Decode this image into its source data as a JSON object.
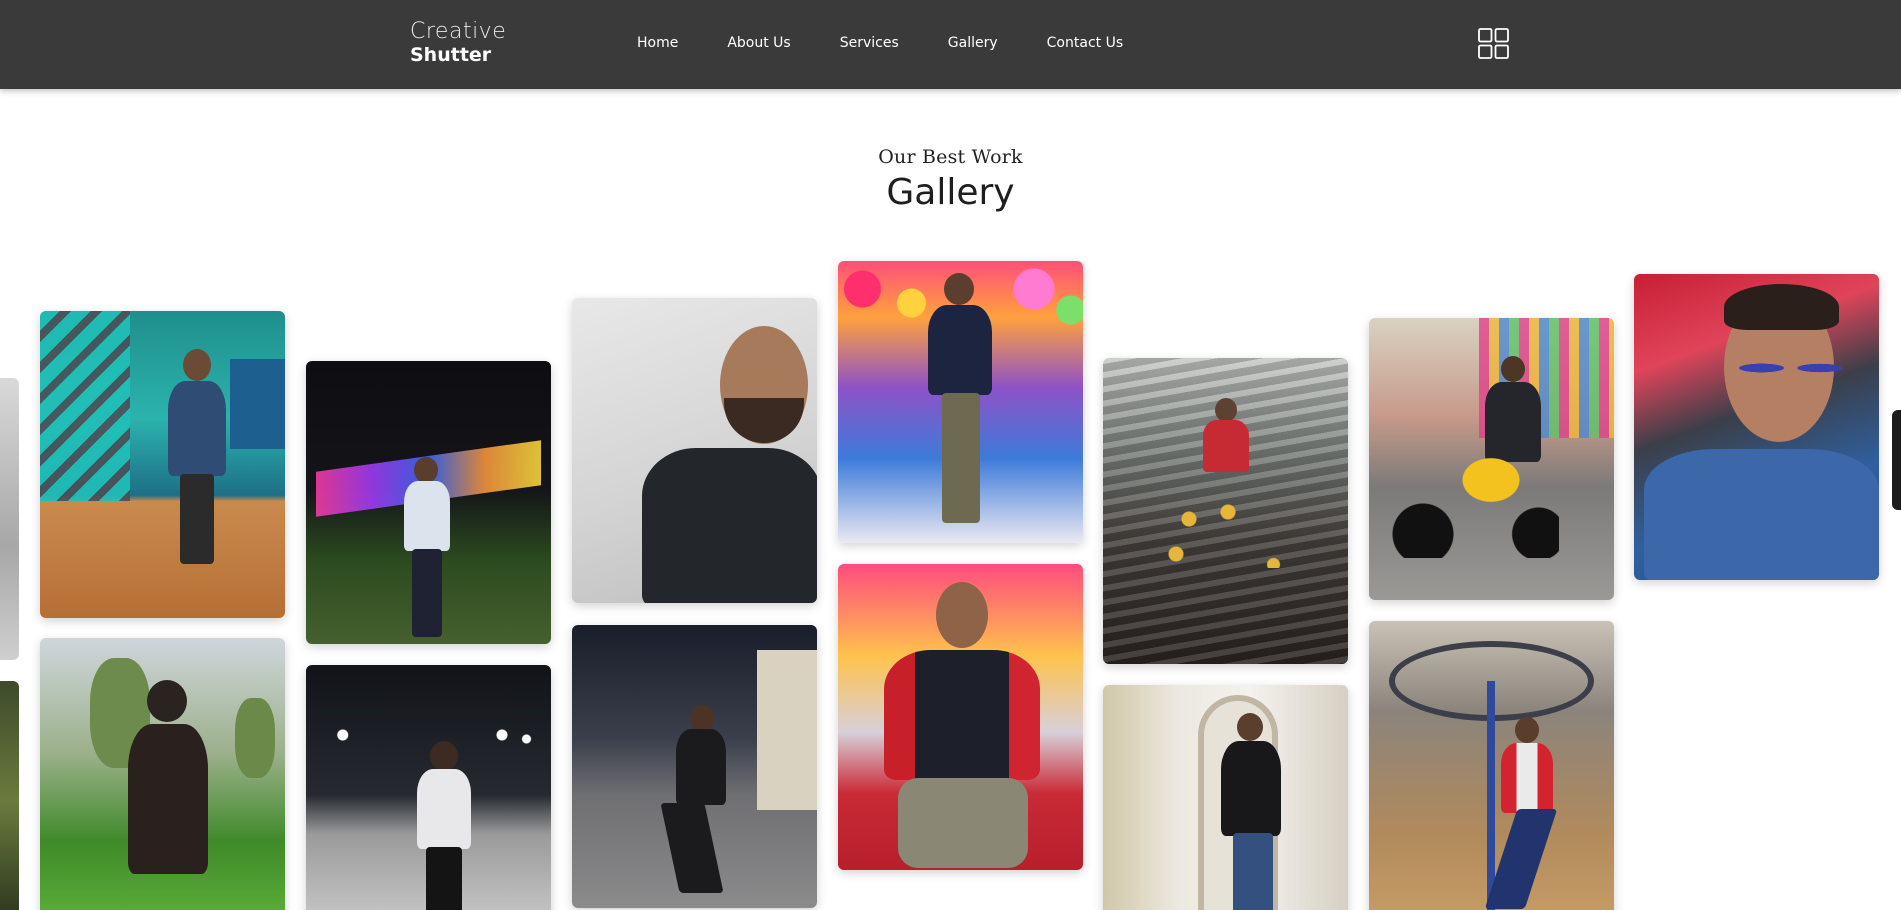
{
  "header": {
    "brand_line1": "Creative",
    "brand_line2": "Shutter",
    "nav": [
      {
        "label": "Home"
      },
      {
        "label": "About Us"
      },
      {
        "label": "Services"
      },
      {
        "label": "Gallery"
      },
      {
        "label": "Contact Us"
      }
    ],
    "menu_icon": "grid-icon"
  },
  "section": {
    "subtitle": "Our Best Work",
    "title": "Gallery"
  },
  "colors": {
    "header_bg": "#3a3a3a",
    "page_bg": "#ffffff",
    "text_dark": "#222222"
  },
  "gallery": {
    "photos": [
      {
        "scene": "teal-mural-portrait"
      },
      {
        "scene": "tea-garden-portrait"
      },
      {
        "scene": "neon-lights-night"
      },
      {
        "scene": "night-lamps-path"
      },
      {
        "scene": "closeup-selfie-grey"
      },
      {
        "scene": "night-road-suit"
      },
      {
        "scene": "floral-stage-portrait"
      },
      {
        "scene": "red-sofa-portrait"
      },
      {
        "scene": "rocky-wall-seated"
      },
      {
        "scene": "palace-doorway"
      },
      {
        "scene": "motorcycle-market"
      },
      {
        "scene": "mall-dance-pose"
      },
      {
        "scene": "car-selfie-sunglasses"
      }
    ]
  }
}
